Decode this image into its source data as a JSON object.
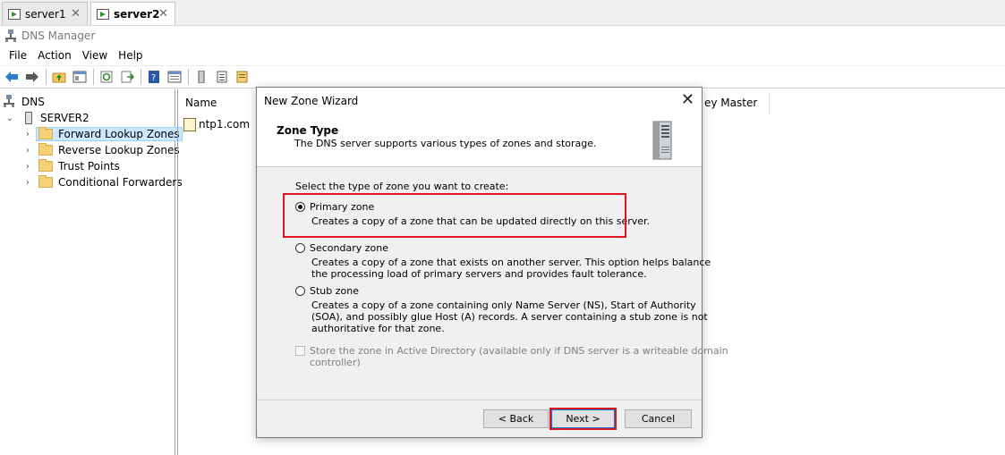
{
  "tabs": [
    {
      "label": "server1",
      "active": false
    },
    {
      "label": "server2",
      "active": true
    }
  ],
  "app": {
    "title": "DNS Manager"
  },
  "menu": [
    "File",
    "Action",
    "View",
    "Help"
  ],
  "tree": {
    "root": "DNS",
    "server": "SERVER2",
    "items": [
      "Forward Lookup Zones",
      "Reverse Lookup Zones",
      "Trust Points",
      "Conditional Forwarders"
    ],
    "selected_index": 0
  },
  "list": {
    "columns": [
      "Name",
      "ey Master"
    ],
    "rows": [
      "ntp1.com"
    ]
  },
  "dialog": {
    "title": "New Zone Wizard",
    "header_title": "Zone Type",
    "header_subtitle": "The DNS server supports various types of zones and storage.",
    "prompt": "Select the type of zone you want to create:",
    "options": [
      {
        "label": "Primary zone",
        "checked": true,
        "desc": [
          "Creates a copy of a zone that can be updated directly on this server."
        ]
      },
      {
        "label": "Secondary zone",
        "checked": false,
        "desc": [
          "Creates a copy of a zone that exists on another server. This option helps balance",
          "the processing load of primary servers and provides fault tolerance."
        ]
      },
      {
        "label": "Stub zone",
        "checked": false,
        "desc": [
          "Creates a copy of a zone containing only Name Server (NS), Start of Authority",
          "(SOA), and possibly glue Host (A) records. A server containing a stub zone is not",
          "authoritative for that zone."
        ]
      }
    ],
    "store_ad": {
      "label_line1": "Store the zone in Active Directory (available only if DNS server is a writeable domain",
      "label_line2": "controller)",
      "checked": false,
      "enabled": false
    },
    "buttons": {
      "back": "< Back",
      "next": "Next >",
      "cancel": "Cancel"
    }
  },
  "colors": {
    "highlight": "#e0141e",
    "selection": "#cce8ff"
  }
}
